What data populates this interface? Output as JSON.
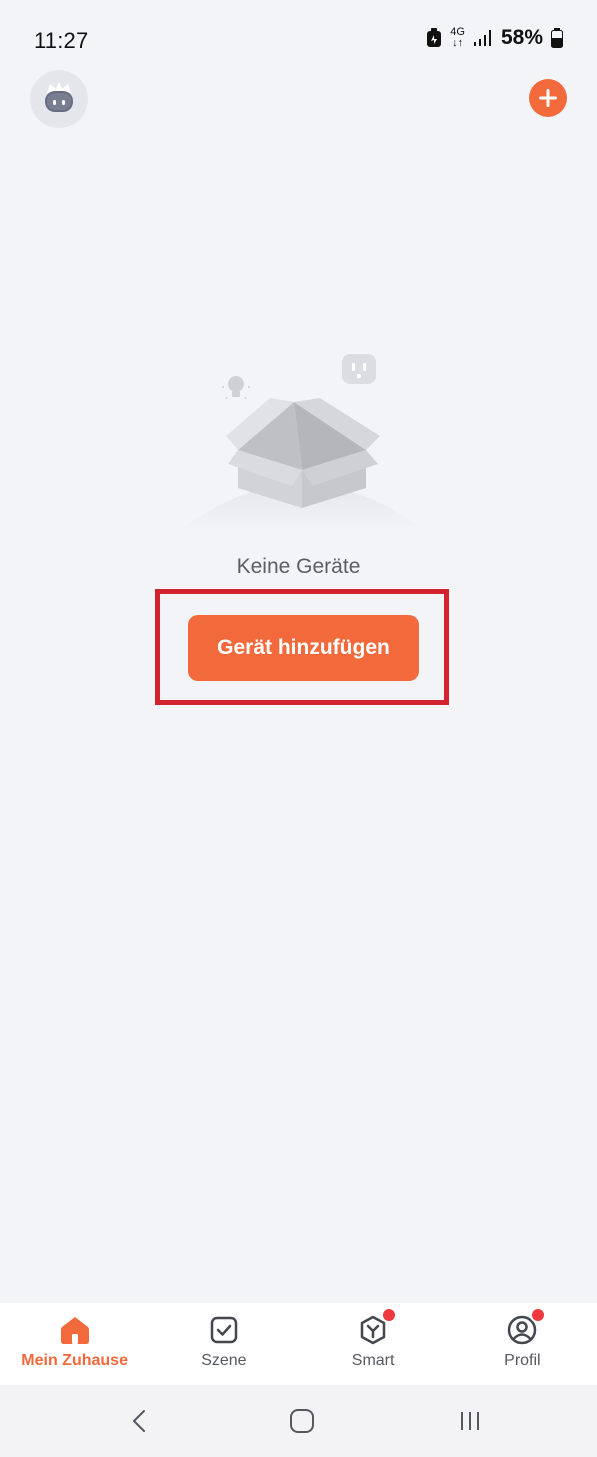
{
  "status_bar": {
    "time": "11:27",
    "network_top": "4G",
    "network_bottom": "↓↑",
    "battery_percent": "58%"
  },
  "header": {
    "avatar_icon": "robot-avatar-icon",
    "add_icon": "plus-icon"
  },
  "empty_state": {
    "message": "Keine Geräte",
    "button_label": "Gerät hinzufügen",
    "illustration_icon": "open-box-icon"
  },
  "tabs": [
    {
      "label": "Mein Zuhause",
      "icon": "home-icon",
      "active": true,
      "badge": false
    },
    {
      "label": "Szene",
      "icon": "checkbox-icon",
      "active": false,
      "badge": false
    },
    {
      "label": "Smart",
      "icon": "cube-icon",
      "active": false,
      "badge": true
    },
    {
      "label": "Profil",
      "icon": "user-circle-icon",
      "active": false,
      "badge": true
    }
  ],
  "system_nav": {
    "back_icon": "chevron-left-icon",
    "home_icon": "rounded-square-icon",
    "recents_icon": "three-bars-icon"
  },
  "colors": {
    "accent": "#F26A3C",
    "background": "#F3F4F8",
    "highlight": "#D2232F",
    "badge": "#EE3A3F"
  }
}
